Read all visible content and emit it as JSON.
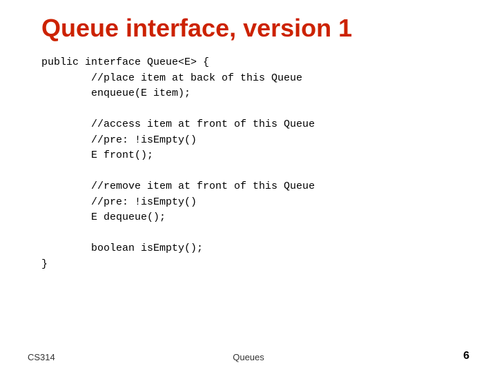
{
  "slide": {
    "title": "Queue interface, version 1",
    "code": "public interface Queue<E> {\n        //place item at back of this Queue\n        enqueue(E item);\n\n        //access item at front of this Queue\n        //pre: !isEmpty()\n        E front();\n\n        //remove item at front of this Queue\n        //pre: !isEmpty()\n        E dequeue();\n\n        boolean isEmpty();\n}",
    "footer_left": "CS314",
    "footer_center": "Queues",
    "footer_right": "6"
  }
}
